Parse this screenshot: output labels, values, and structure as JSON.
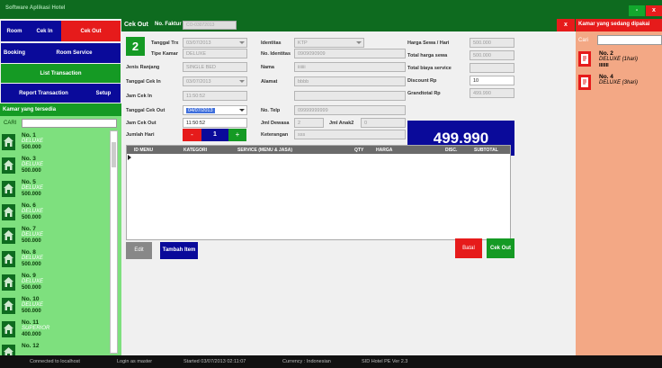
{
  "window": {
    "title": "Software Aplikasi Hotel",
    "min_label": "-",
    "close_label": "x"
  },
  "nav": {
    "room": "Room",
    "cek_in": "Cek In",
    "cek_out": "Cek Out",
    "booking": "Booking",
    "room_service": "Room Service",
    "list_transaction": "List Transaction",
    "report_transaction": "Report Transaction",
    "setup": "Setup"
  },
  "available": {
    "title": "Kamar yang tersedia",
    "search_label": "CARI",
    "rooms": [
      {
        "no": "No. 1",
        "type": "DELUXE",
        "price": "500.000"
      },
      {
        "no": "No. 3",
        "type": "DELUXE",
        "price": "500.000"
      },
      {
        "no": "No. 5",
        "type": "DELUXE",
        "price": "500.000"
      },
      {
        "no": "No. 6",
        "type": "DELUXE",
        "price": "500.000"
      },
      {
        "no": "No. 7",
        "type": "DELUXE",
        "price": "500.000"
      },
      {
        "no": "No. 8",
        "type": "DELUXE",
        "price": "500.000"
      },
      {
        "no": "No. 9",
        "type": "DELUXE",
        "price": "500.000"
      },
      {
        "no": "No. 10",
        "type": "DELUXE",
        "price": "500.000"
      },
      {
        "no": "No. 11",
        "type": "SUPERIOR",
        "price": "400.000"
      },
      {
        "no": "No. 12",
        "type": "",
        "price": ""
      }
    ]
  },
  "checkout": {
    "header": "Cek Out",
    "no_faktur_label": "No. Faktur",
    "no_faktur_value": "CO-03072013",
    "room_no": "2",
    "tanggal_trx_label": "Tanggal Trx",
    "tanggal_trx_value": "03/07/2013",
    "tipe_kamar_label": "Tipe Kamar",
    "tipe_kamar_value": "DELUXE",
    "jenis_ranjang_label": "Jenis Ranjang",
    "jenis_ranjang_value": "SINGLE BED",
    "tanggal_cek_in_label": "Tanggal Cek In",
    "tanggal_cek_in_value": "03/07/2013",
    "jam_cek_in_label": "Jam Cek In",
    "jam_cek_in_value": "11:50:52",
    "tanggal_cek_out_label": "Tanggal Cek Out",
    "tanggal_cek_out_value": "04/07/2013",
    "jam_cek_out_label": "Jam Cek Out",
    "jam_cek_out_value": "11:50:52",
    "jumlah_hari_label": "Jumlah Hari",
    "jumlah_hari_value": "1",
    "minus": "-",
    "plus": "+",
    "identitas_label": "Identitas",
    "identitas_value": "KTP",
    "no_identitas_label": "No. Identitas",
    "no_identitas_value": "0909090909",
    "nama_label": "Nama",
    "nama_value": "iiiiiii",
    "alamat_label": "Alamat",
    "alamat_value": "bbbb",
    "alamat2_value": "",
    "no_telp_label": "No. Telp",
    "no_telp_value": "09999999999",
    "jml_dewasa_label": "Jml Dewasa",
    "jml_dewasa_value": "2",
    "jml_anak_label": "Jml Anak2",
    "jml_anak_value": "0",
    "keterangan_label": "Keterangan",
    "keterangan_value": "sss",
    "harga_sewa_label": "Harga Sewa / Hari",
    "harga_sewa_value": "500.000",
    "total_harga_label": "Total harga sewa",
    "total_harga_value": "500.000",
    "total_service_label": "Total biaya service",
    "total_service_value": "",
    "discount_label": "Discount Rp",
    "discount_value": "10",
    "grandtotal_label": "Grandtotal Rp",
    "grandtotal_value": "499.990",
    "total_display": "499.990",
    "grid_columns": [
      "ID MENU",
      "KATEGORI",
      "SERVICE (MENU & JASA)",
      "QTY",
      "HARGA",
      "DISC.",
      "SUBTOTAL"
    ],
    "edit": "Edit",
    "tambah": "Tambah Item",
    "batal": "Batal",
    "cek_out": "Cek Out",
    "close": "x"
  },
  "occupied": {
    "title": "Kamar yang sedang dipakai",
    "search_label": "Cari",
    "rooms": [
      {
        "no": "No. 2",
        "type": "DELUXE (1hari)",
        "extra": "IIIIIII"
      },
      {
        "no": "No. 4",
        "type": "DELUXE (3hari)",
        "extra": ""
      }
    ]
  },
  "status": {
    "connected": "Connected to localhost",
    "login": "Login as master",
    "started": "Started 03/07/2013 02:11:07",
    "currency": "Currency : Indonesian",
    "version": "SID Hotel PE Ver 2.3"
  },
  "colors": {
    "green": "#159a24",
    "dark_green": "#0e6b1f",
    "blue": "#0a0a9a",
    "red": "#e61b1b",
    "salmon": "#f3a885"
  }
}
